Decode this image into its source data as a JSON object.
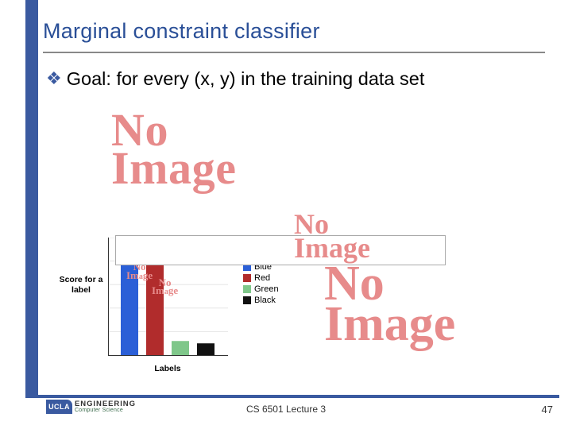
{
  "title": "Marginal constraint classifier",
  "bullet": {
    "prefix": "Goal: ",
    "text": "for every (x, y) in the training data set"
  },
  "no_image_lines": {
    "l1": "No",
    "l2": "Image"
  },
  "chart_data": {
    "type": "bar",
    "categories": [
      "Blue",
      "Red",
      "Green",
      "Black"
    ],
    "series": [
      {
        "name": "Blue",
        "color": "#2b5fd7",
        "values": [
          95
        ]
      },
      {
        "name": "Red",
        "color": "#b12c2c",
        "values": [
          82
        ]
      },
      {
        "name": "Green",
        "color": "#7fc78a",
        "values": [
          12
        ]
      },
      {
        "name": "Black",
        "color": "#111111",
        "values": [
          10
        ]
      }
    ],
    "ylabel": "Score for a label",
    "xlabel": "Labels",
    "ylim": [
      0,
      100
    ],
    "inner_placeholder": "No Image"
  },
  "footer": {
    "logo_ucla": "UCLA",
    "logo_eng": "ENGINEERING",
    "logo_cs": "Computer Science",
    "center": "CS 6501 Lecture 3",
    "right": "47"
  }
}
